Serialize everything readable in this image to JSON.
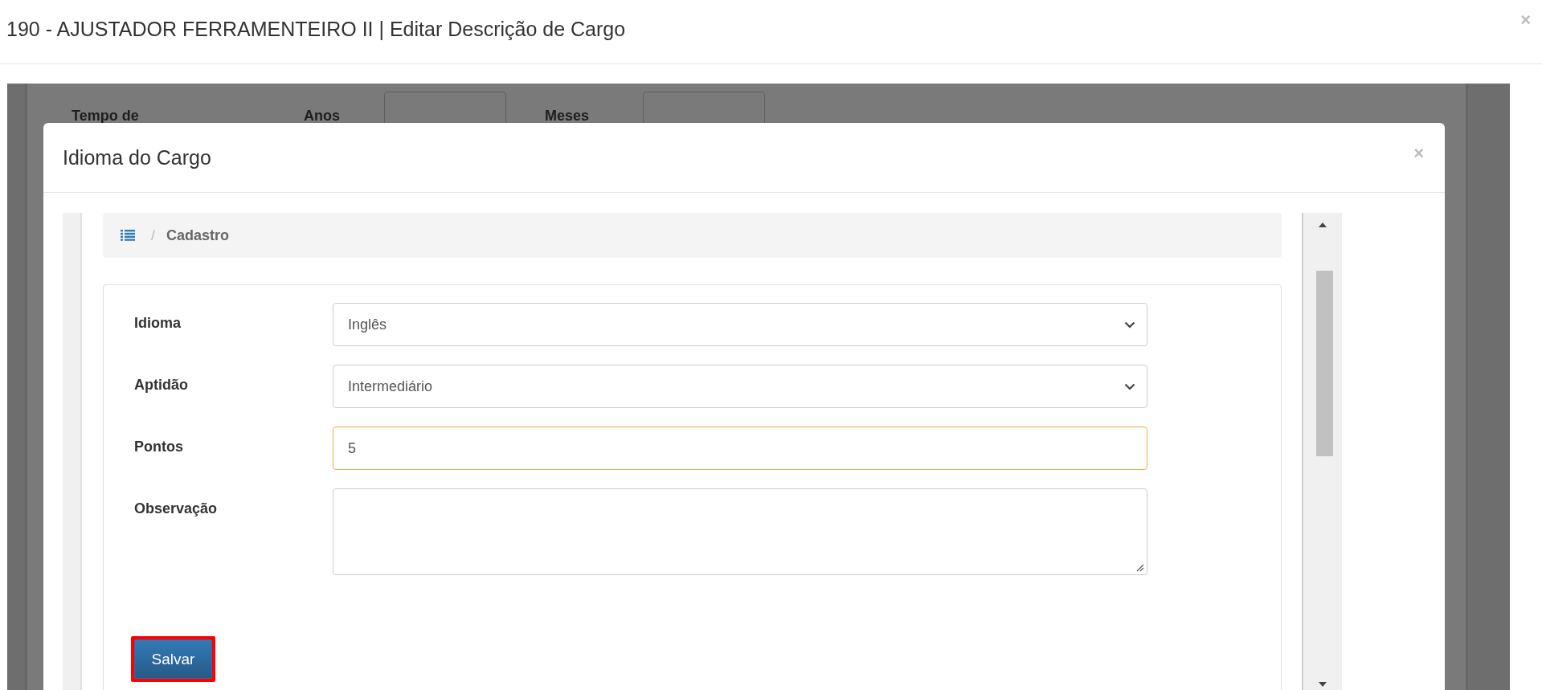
{
  "window": {
    "title": "190 - AJUSTADOR FERRAMENTEIRO II | Editar Descrição de Cargo",
    "close": "×"
  },
  "background_form": {
    "fields": [
      {
        "label": "Tempo de",
        "kind": "label"
      },
      {
        "label": "Anos",
        "kind": "input"
      },
      {
        "label": "Meses",
        "kind": "input"
      }
    ]
  },
  "dialog": {
    "title": "Idioma do Cargo",
    "close": "×",
    "breadcrumb_separator": "/",
    "breadcrumb": "Cadastro",
    "fields": [
      {
        "label": "Idioma",
        "kind": "select",
        "value": "Inglês",
        "focused": false
      },
      {
        "label": "Aptidão",
        "kind": "select",
        "value": "Intermediário",
        "focused": false
      },
      {
        "label": "Pontos",
        "kind": "input",
        "value": "5",
        "focused": true
      },
      {
        "label": "Observação",
        "kind": "textarea",
        "focused": false
      }
    ],
    "save_button": {
      "label": "Salvar",
      "highlighted": true
    }
  }
}
